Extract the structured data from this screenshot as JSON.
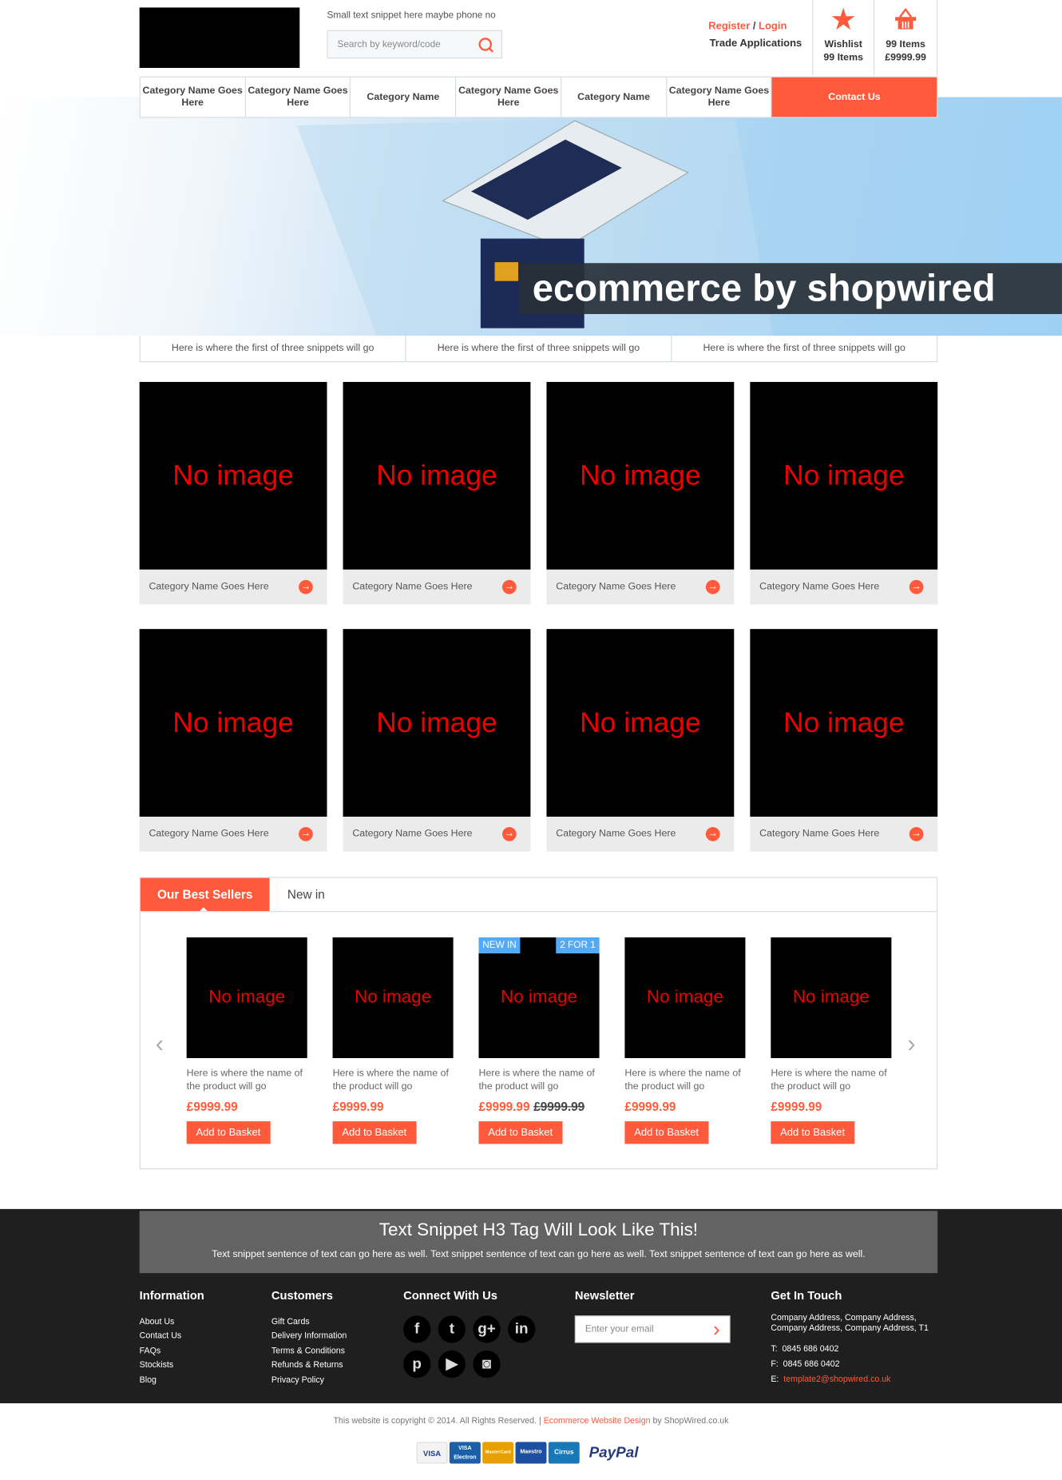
{
  "header": {
    "snippet": "Small text snippet here maybe phone no",
    "search_placeholder": "Search by keyword/code",
    "register": "Register",
    "slash": "/",
    "login": "Login",
    "trade": "Trade Applications",
    "wishlist_label": "Wishlist",
    "wishlist_count": "99 Items",
    "basket_count": "99 Items",
    "basket_total": "£9999.99"
  },
  "nav": {
    "items": [
      "Category Name Goes Here",
      "Category Name Goes Here",
      "Category Name",
      "Category Name Goes Here",
      "Category Name",
      "Category Name Goes Here"
    ],
    "contact": "Contact Us"
  },
  "hero": {
    "title": "ecommerce by shopwired"
  },
  "snippets": [
    "Here is where the first of three snippets will go",
    "Here is where the first of three snippets will go",
    "Here is where the first of three snippets will go"
  ],
  "categories": {
    "no_image": "No image",
    "items": [
      "Category Name Goes Here",
      "Category Name Goes Here",
      "Category Name Goes Here",
      "Category Name Goes Here",
      "Category Name Goes Here",
      "Category Name Goes Here",
      "Category Name Goes Here",
      "Category Name Goes Here"
    ]
  },
  "tabs": {
    "active": "Our Best Sellers",
    "other": "New in"
  },
  "products": {
    "no_image": "No image",
    "name": "Here is where the name of the product will go",
    "price": "£9999.99",
    "old_price": "£9999.99",
    "add": "Add to Basket",
    "badge_new": "NEW IN",
    "badge_offer": "2 FOR 1"
  },
  "promo": {
    "title": "Text Snippet H3 Tag Will Look Like This!",
    "text": "Text snippet sentence of text can go here as well. Text snippet sentence of text can go here as well. Text snippet sentence of text can go here as well."
  },
  "footer": {
    "information": {
      "title": "Information",
      "links": [
        "About Us",
        "Contact Us",
        "FAQs",
        "Stockists",
        "Blog"
      ]
    },
    "customers": {
      "title": "Customers",
      "links": [
        "Gift Cards",
        "Delivery Information",
        "Terms & Conditions",
        "Refunds & Returns",
        "Privacy Policy"
      ]
    },
    "connect": {
      "title": "Connect With Us"
    },
    "newsletter": {
      "title": "Newsletter",
      "placeholder": "Enter your email"
    },
    "contact": {
      "title": "Get In Touch",
      "address": "Company Address, Company Address, Company Address, Company Address, T1",
      "t_label": "T:",
      "phone": "0845 686 0402",
      "f_label": "F:",
      "fax": "0845 686 0402",
      "e_label": "E:",
      "email": "template2@shopwired.co.uk"
    }
  },
  "copyright": {
    "text": "This website is copyright © 2014. All Rights Reserved.  |",
    "link": "Ecommerce Website Design",
    "by": "by ShopWired.co.uk"
  },
  "payments": [
    "VISA",
    "VISA Electron",
    "MasterCard",
    "Maestro",
    "Cirrus",
    "PayPal"
  ],
  "colors": {
    "accent": "#ff5a3c",
    "badge": "#55aaf5",
    "footer": "#1f1f1f"
  }
}
